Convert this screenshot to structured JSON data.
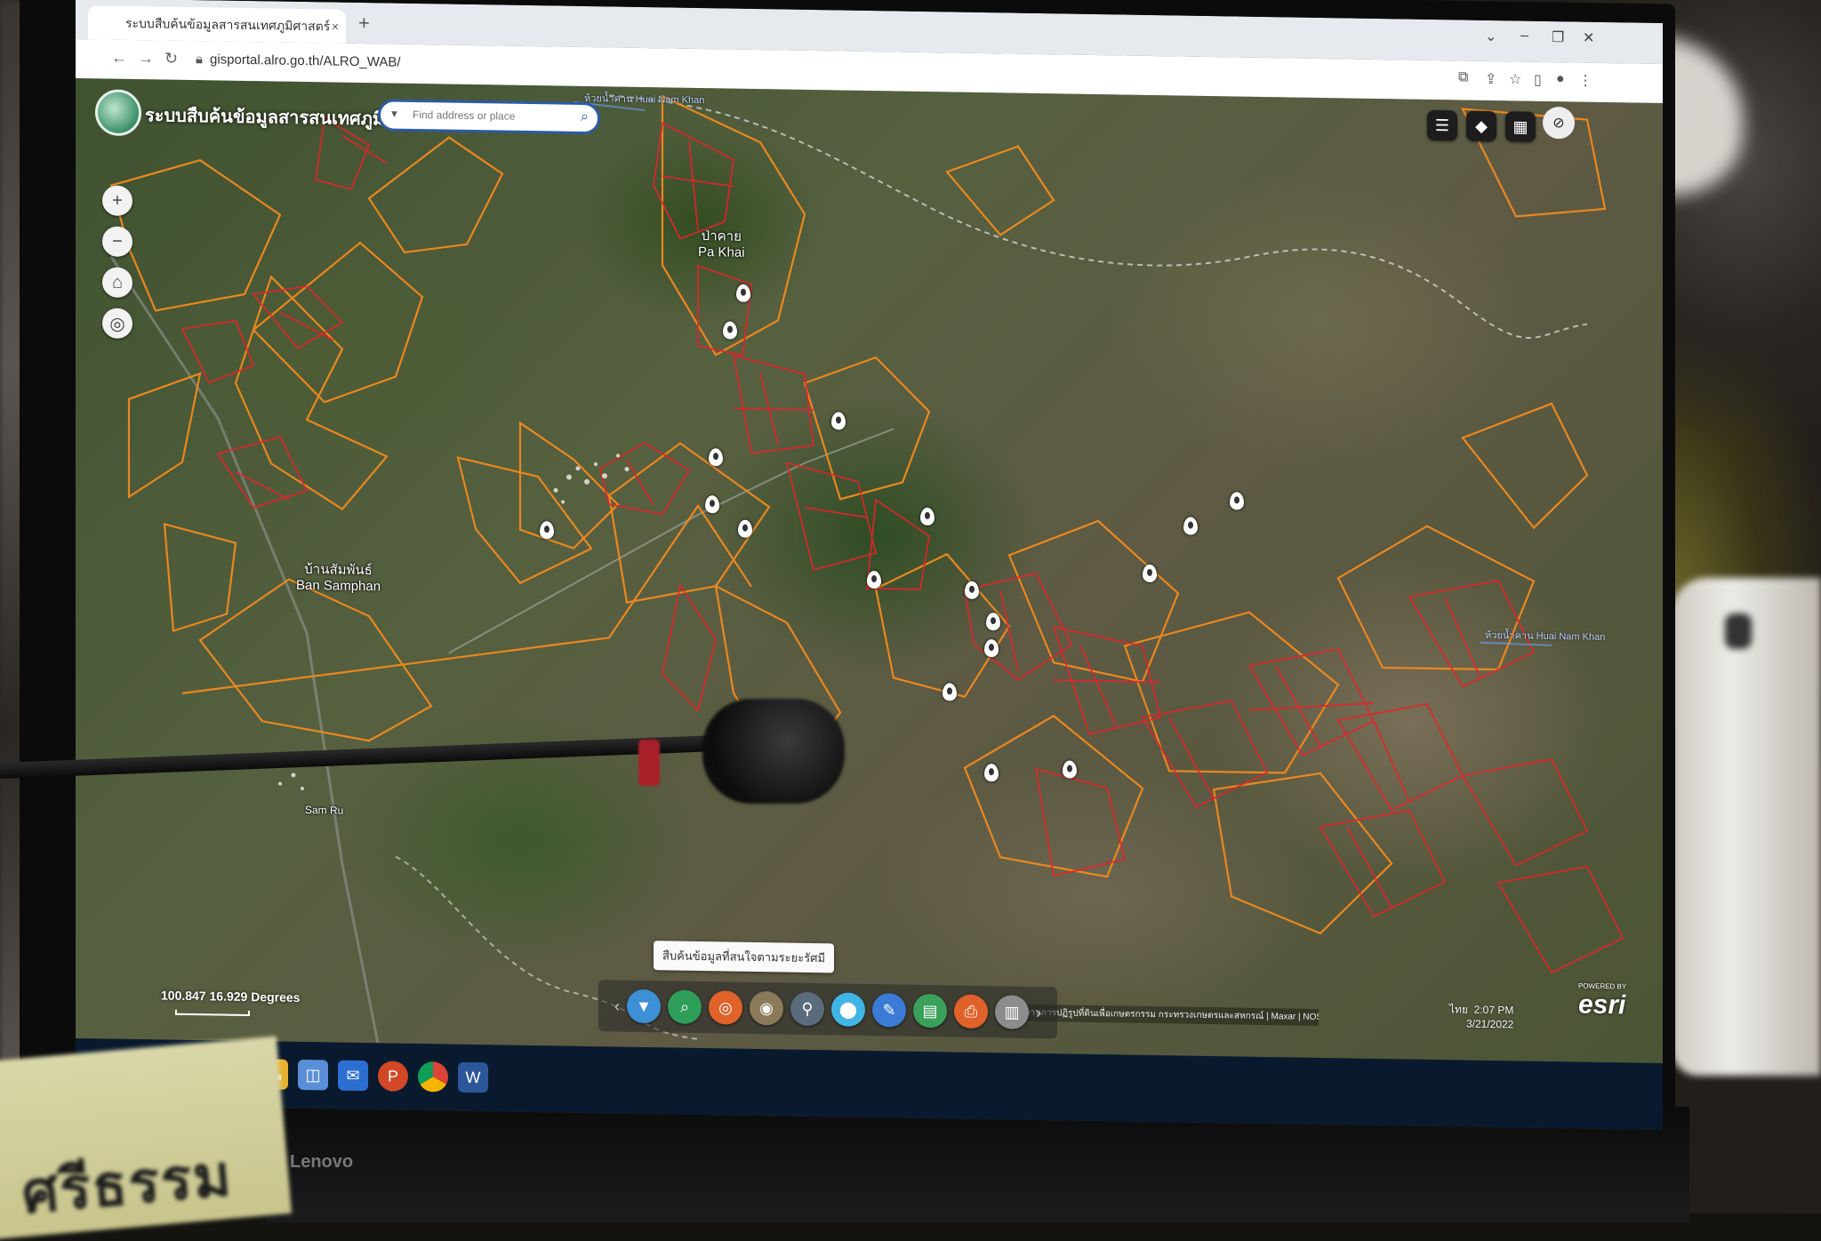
{
  "browser": {
    "tab_title": "ระบบสืบค้นข้อมูลสารสนเทศภูมิศาสตร์",
    "tab_close": "×",
    "new_tab": "+",
    "url": "gisportal.alro.go.th/ALRO_WAB/",
    "window_controls": [
      "⌄",
      "–",
      "❐",
      "✕"
    ]
  },
  "map": {
    "app_title": "ระบบสืบค้นข้อมูลสารสนเทศภูมิศาสตร์",
    "search_placeholder": "Find address or place",
    "labels": {
      "pa_khai_th": "ป่าคาย",
      "pa_khai_en": "Pa Khai",
      "ban_samphan_th": "บ้านสัมพันธ์",
      "ban_samphan_en": "Ban Samphan",
      "sam_ru": "Sam Ru",
      "river_1": "ห้วยน้ำคาน Huai Nam Khan",
      "river_2": "ห้วยน้ำคาน Huai Nam Khan"
    },
    "coords_readout": "100.847 16.929 Degrees",
    "attribution": "สำนักงานการปฏิรูปที่ดินเพื่อเกษตรกรรม กระทรวงเกษตรและสหกรณ์ | Maxar | NOSTRA, Esri, HERE, Garmin",
    "esri_powered": "POWERED BY",
    "esri_logo": "esri",
    "tooltip": "สืบค้นข้อมูลที่สนใจตามระยะรัศมี",
    "icons": {
      "zoom_in": "zoom-in-icon",
      "zoom_out": "zoom-out-icon",
      "home": "home-icon",
      "locate": "locate-icon",
      "layer_list": "layer-list-icon",
      "basemap": "basemap-icon",
      "widgets": "widget-grid-icon",
      "visibility": "eye-off-icon"
    },
    "dock_tools": [
      {
        "name": "filter-icon",
        "color": "#3d8fd6",
        "glyph": "▼"
      },
      {
        "name": "search-icon",
        "color": "#2e9e5a",
        "glyph": "⌕"
      },
      {
        "name": "query-icon",
        "color": "#e0622a",
        "glyph": "◎"
      },
      {
        "name": "radius-search-icon",
        "color": "#8a7a5a",
        "glyph": "◉"
      },
      {
        "name": "user-icon",
        "color": "#5a6b7c",
        "glyph": "⚲"
      },
      {
        "name": "location-icon",
        "color": "#41b6e6",
        "glyph": "⬤"
      },
      {
        "name": "draw-icon",
        "color": "#3b7bd6",
        "glyph": "✎"
      },
      {
        "name": "report-icon",
        "color": "#3aa05a",
        "glyph": "▤"
      },
      {
        "name": "print-icon",
        "color": "#e0622a",
        "glyph": "⎙"
      },
      {
        "name": "document-icon",
        "color": "#8c8c8c",
        "glyph": "▥"
      }
    ]
  },
  "tray": {
    "time": "2:07 PM",
    "date": "3/21/2022",
    "lang": "ไทย"
  },
  "nameplate_text": "ศรีธรรม",
  "monitor_brand": "Lenovo"
}
